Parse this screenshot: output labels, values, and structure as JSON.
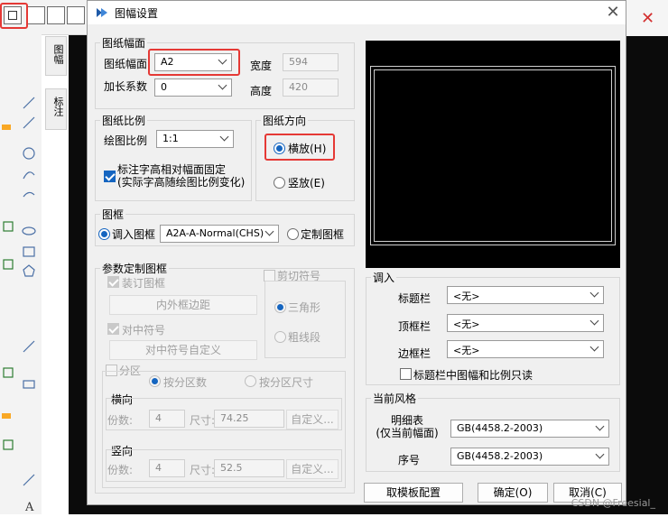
{
  "dialog": {
    "title": "图幅设置",
    "paper_size": {
      "group_title": "图纸幅面",
      "size_label": "图纸幅面",
      "size_value": "A2",
      "extend_label": "加长系数",
      "extend_value": "0",
      "width_label": "宽度",
      "width_value": "594",
      "height_label": "高度",
      "height_value": "420"
    },
    "scale": {
      "group_title": "图纸比例",
      "scale_label": "绘图比例",
      "scale_value": "1:1",
      "fix_text_line1": "标注字高相对幅面固定",
      "fix_text_line2": "(实际字高随绘图比例变化)",
      "fix_text_checked": true
    },
    "orientation": {
      "group_title": "图纸方向",
      "landscape_label": "横放(H)",
      "portrait_label": "竖放(E)",
      "selected": "landscape"
    },
    "frame": {
      "group_title": "图框",
      "load_label": "调入图框",
      "load_value": "A2A-A-Normal(CHS)",
      "custom_label": "定制图框",
      "selected": "load"
    },
    "param_frame": {
      "group_title": "参数定制图框",
      "binding_label": "装订图框",
      "inner_outer_button": "内外框边距",
      "center_mark_label": "对中符号",
      "center_mark_button": "对中符号自定义",
      "cut_mark_label": "剪切符号",
      "triangle_label": "三角形",
      "thick_line_label": "粗线段",
      "zone_label": "分区",
      "by_count_label": "按分区数",
      "by_size_label": "按分区尺寸",
      "horizontal": {
        "title": "横向",
        "count_label": "份数:",
        "count_value": "4",
        "size_label": "尺寸:",
        "size_value": "74.25",
        "custom_button": "自定义..."
      },
      "vertical": {
        "title": "竖向",
        "count_label": "份数:",
        "count_value": "4",
        "size_label": "尺寸:",
        "size_value": "52.5",
        "custom_button": "自定义..."
      }
    },
    "load_in": {
      "group_title": "调入",
      "title_block_label": "标题栏",
      "title_block_value": "<无>",
      "top_block_label": "顶框栏",
      "top_block_value": "<无>",
      "side_block_label": "边框栏",
      "side_block_value": "<无>",
      "readonly_check_label": "标题栏中图幅和比例只读"
    },
    "current_style": {
      "group_title": "当前风格",
      "detail_label_line1": "明细表",
      "detail_label_line2": "(仅当前幅面)",
      "detail_value": "GB(4458.2-2003)",
      "serial_label": "序号",
      "serial_value": "GB(4458.2-2003)"
    },
    "buttons": {
      "template": "取模板配置",
      "ok": "确定(O)",
      "cancel": "取消(C)"
    }
  },
  "background": {
    "vtab_top": "图幅",
    "vtab_bottom": "标注",
    "watermark": "CSDN @Freesial_"
  },
  "colors": {
    "highlight": "#e53935",
    "radio_accent": "#1565c0",
    "preview_bg": "#000000"
  }
}
